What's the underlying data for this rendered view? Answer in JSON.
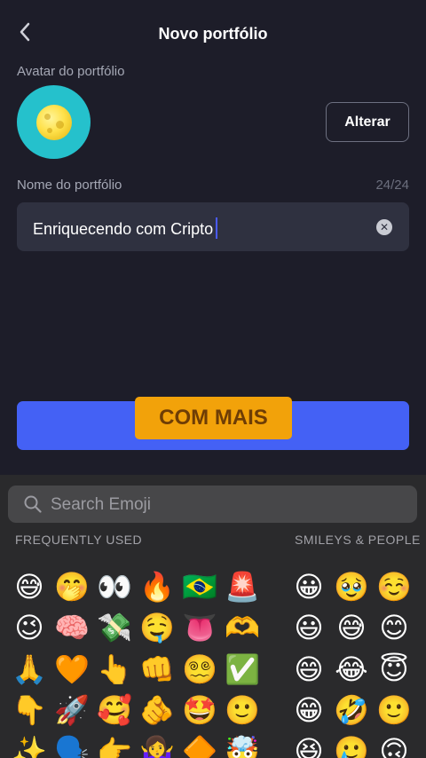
{
  "header": {
    "title": "Novo portfólio"
  },
  "avatar": {
    "label": "Avatar do portfólio",
    "change_button": "Alterar"
  },
  "name": {
    "label": "Nome do portfólio",
    "counter": "24/24",
    "value": "Enriquecendo com Cripto"
  },
  "overlay_text": "COM MAIS",
  "keyboard": {
    "search_placeholder": "Search Emoji",
    "sections": [
      "FREQUENTLY USED",
      "SMILEYS & PEOPLE"
    ],
    "frequent": [
      [
        "😅",
        "🤭",
        "👀",
        "🔥",
        "🇧🇷",
        "🚨"
      ],
      [
        "😉",
        "🧠",
        "💸",
        "🤤",
        "👅",
        "🫶"
      ],
      [
        "🙏",
        "🧡",
        "👆",
        "👊",
        "😵‍💫",
        "✅"
      ],
      [
        "👇",
        "🚀",
        "🥰",
        "🫵",
        "🤩",
        "🙂"
      ],
      [
        "✨",
        "🗣️",
        "👉",
        "🤷‍♀️",
        "🔶",
        "🤯"
      ]
    ],
    "smileys": [
      [
        "😀",
        "🥹",
        "☺️"
      ],
      [
        "😃",
        "😅",
        "😊"
      ],
      [
        "😄",
        "😂",
        "😇"
      ],
      [
        "😁",
        "🤣",
        "🙂"
      ],
      [
        "😆",
        "🥲",
        "🙃"
      ]
    ]
  }
}
